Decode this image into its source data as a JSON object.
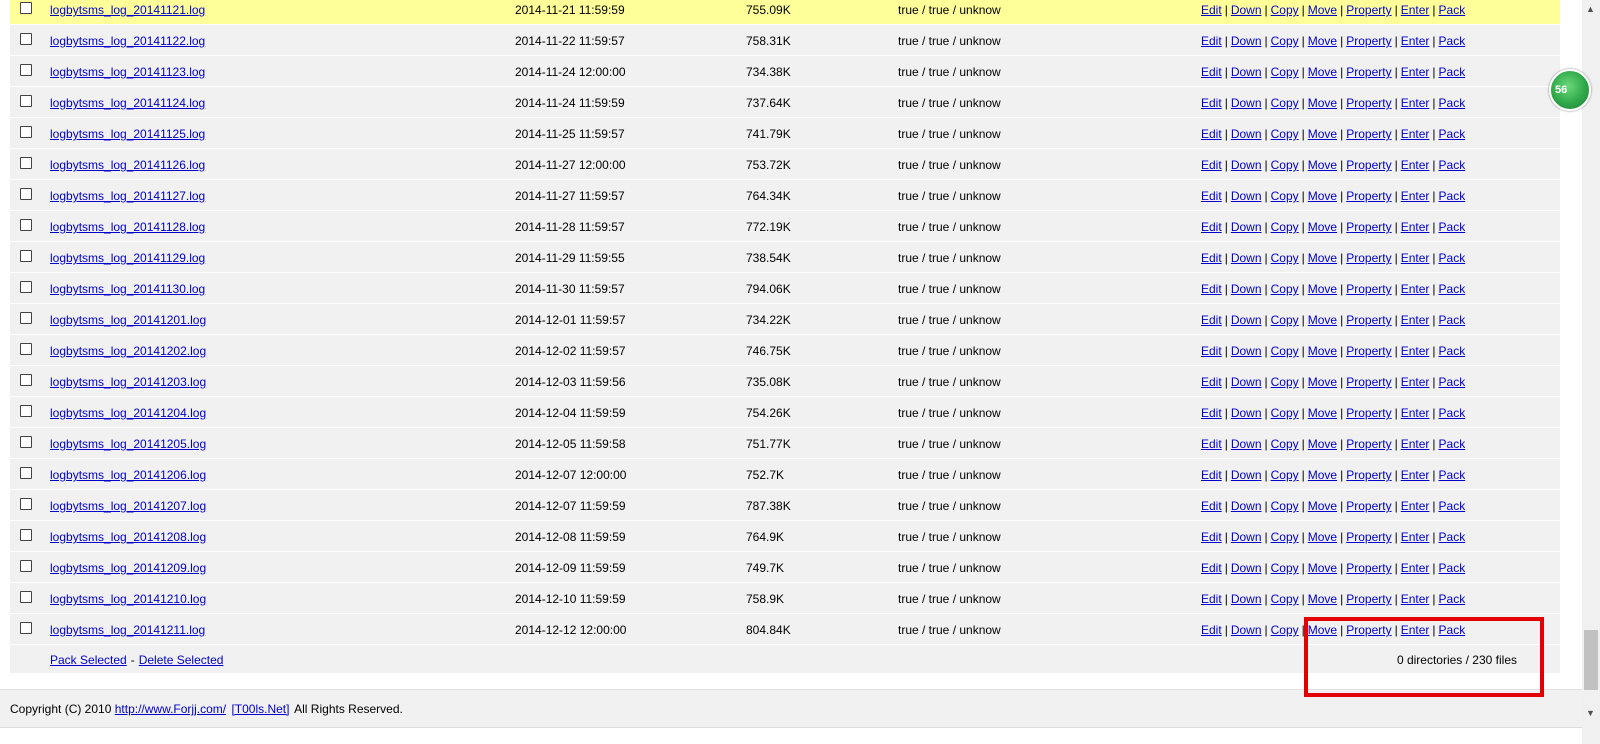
{
  "files": [
    {
      "name": "logbytsms_log_20141121.log",
      "date": "2014-11-21 11:59:59",
      "size": "755.09K",
      "perm": "true / true / unknow"
    },
    {
      "name": "logbytsms_log_20141122.log",
      "date": "2014-11-22 11:59:57",
      "size": "758.31K",
      "perm": "true / true / unknow"
    },
    {
      "name": "logbytsms_log_20141123.log",
      "date": "2014-11-24 12:00:00",
      "size": "734.38K",
      "perm": "true / true / unknow"
    },
    {
      "name": "logbytsms_log_20141124.log",
      "date": "2014-11-24 11:59:59",
      "size": "737.64K",
      "perm": "true / true / unknow"
    },
    {
      "name": "logbytsms_log_20141125.log",
      "date": "2014-11-25 11:59:57",
      "size": "741.79K",
      "perm": "true / true / unknow"
    },
    {
      "name": "logbytsms_log_20141126.log",
      "date": "2014-11-27 12:00:00",
      "size": "753.72K",
      "perm": "true / true / unknow"
    },
    {
      "name": "logbytsms_log_20141127.log",
      "date": "2014-11-27 11:59:57",
      "size": "764.34K",
      "perm": "true / true / unknow"
    },
    {
      "name": "logbytsms_log_20141128.log",
      "date": "2014-11-28 11:59:57",
      "size": "772.19K",
      "perm": "true / true / unknow"
    },
    {
      "name": "logbytsms_log_20141129.log",
      "date": "2014-11-29 11:59:55",
      "size": "738.54K",
      "perm": "true / true / unknow"
    },
    {
      "name": "logbytsms_log_20141130.log",
      "date": "2014-11-30 11:59:57",
      "size": "794.06K",
      "perm": "true / true / unknow"
    },
    {
      "name": "logbytsms_log_20141201.log",
      "date": "2014-12-01 11:59:57",
      "size": "734.22K",
      "perm": "true / true / unknow"
    },
    {
      "name": "logbytsms_log_20141202.log",
      "date": "2014-12-02 11:59:57",
      "size": "746.75K",
      "perm": "true / true / unknow"
    },
    {
      "name": "logbytsms_log_20141203.log",
      "date": "2014-12-03 11:59:56",
      "size": "735.08K",
      "perm": "true / true / unknow"
    },
    {
      "name": "logbytsms_log_20141204.log",
      "date": "2014-12-04 11:59:59",
      "size": "754.26K",
      "perm": "true / true / unknow"
    },
    {
      "name": "logbytsms_log_20141205.log",
      "date": "2014-12-05 11:59:58",
      "size": "751.77K",
      "perm": "true / true / unknow"
    },
    {
      "name": "logbytsms_log_20141206.log",
      "date": "2014-12-07 12:00:00",
      "size": "752.7K",
      "perm": "true / true / unknow"
    },
    {
      "name": "logbytsms_log_20141207.log",
      "date": "2014-12-07 11:59:59",
      "size": "787.38K",
      "perm": "true / true / unknow"
    },
    {
      "name": "logbytsms_log_20141208.log",
      "date": "2014-12-08 11:59:59",
      "size": "764.9K",
      "perm": "true / true / unknow"
    },
    {
      "name": "logbytsms_log_20141209.log",
      "date": "2014-12-09 11:59:59",
      "size": "749.7K",
      "perm": "true / true / unknow"
    },
    {
      "name": "logbytsms_log_20141210.log",
      "date": "2014-12-10 11:59:59",
      "size": "758.9K",
      "perm": "true / true / unknow"
    },
    {
      "name": "logbytsms_log_20141211.log",
      "date": "2014-12-12 12:00:00",
      "size": "804.84K",
      "perm": "true / true / unknow"
    }
  ],
  "actions": [
    "Edit",
    "Down",
    "Copy",
    "Move",
    "Property",
    "Enter",
    "Pack"
  ],
  "action_separator": "|",
  "footer": {
    "pack_selected": "Pack Selected",
    "dash": "-",
    "delete_selected": "Delete Selected",
    "summary": "0 directories / 230 files"
  },
  "copyright": {
    "prefix": "Copyright (C) 2010",
    "site_link": "http://www.Forjj.com/",
    "tools_link": "[T00ls.Net]",
    "suffix": "All Rights Reserved."
  },
  "badge": "56",
  "scrollbar": {
    "up_arrow": "▲",
    "down_arrow": "▼"
  },
  "colors": {
    "highlight_row": "#ffff99",
    "annotation_box": "#e30000",
    "link": "#0000cc"
  }
}
